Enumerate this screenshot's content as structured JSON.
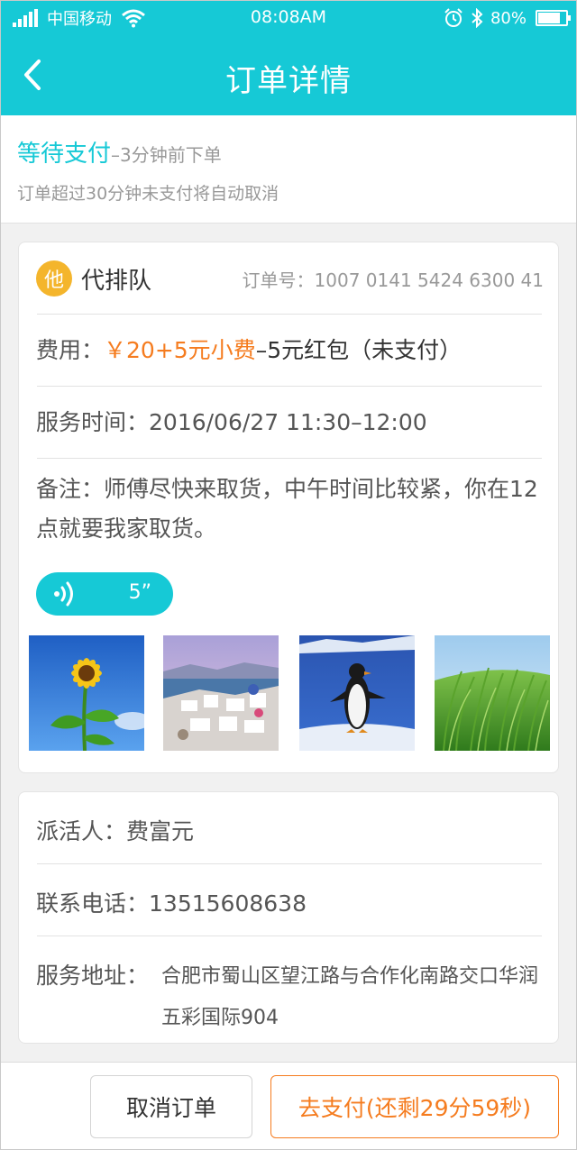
{
  "status_bar": {
    "carrier": "中国移动",
    "time": "08:08AM",
    "battery": "80%",
    "battery_level": 0.8,
    "icons": [
      "signal-icon",
      "wifi-icon",
      "alarm-icon",
      "bluetooth-icon",
      "battery-icon"
    ]
  },
  "header": {
    "title": "订单详情",
    "back_icon": "chevron-left-icon"
  },
  "order_status": {
    "status": "等待支付",
    "dash": "–",
    "sub": "3分钟前下单",
    "note": "订单超过30分钟未支付将自动取消"
  },
  "order": {
    "avatar_char": "他",
    "service": "代排队",
    "order_no": "订单号：1007 0141 5424 6300 41",
    "fee_label": "费用：",
    "fee_amount": "￥20+5元小费",
    "fee_rest": "–5元红包（未支付）",
    "time_label": "服务时间：",
    "time_value": "2016/06/27 11:30–12:00",
    "remark": "备注：师傅尽快来取货，中午时间比较紧，你在12点就要我家取货。",
    "voice_duration": "5”",
    "photos": [
      "sunflower",
      "seaside-town",
      "penguin",
      "wheat-field"
    ]
  },
  "dispatcher": {
    "name_label": "派活人：",
    "name": "费富元",
    "phone_label": "联系电话：",
    "phone": "13515608638",
    "address_label": "服务地址：",
    "address": "合肥市蜀山区望江路与合作化南路交口华润五彩国际904"
  },
  "footer": {
    "cancel": "取消订单",
    "pay": "去支付(还剩29分59秒)"
  },
  "colors": {
    "primary": "#16c9d6",
    "accent": "#f57c1f",
    "avatar": "#f4b52c"
  }
}
